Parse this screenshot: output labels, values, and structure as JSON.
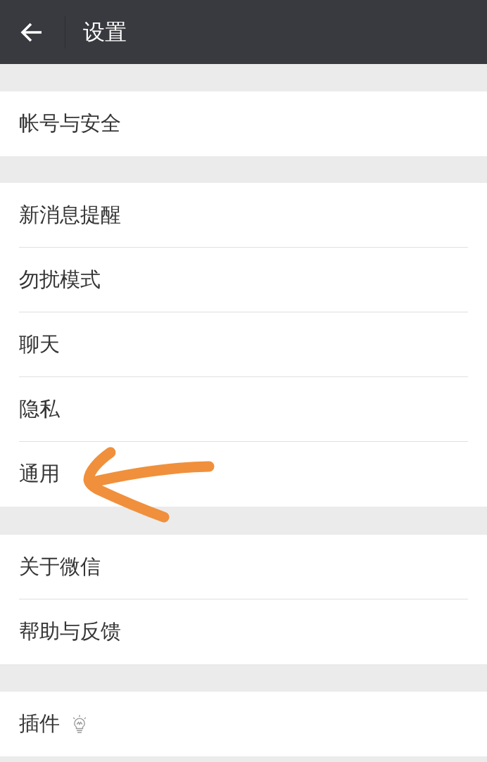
{
  "header": {
    "title": "设置"
  },
  "groups": [
    {
      "rows": [
        {
          "label": "帐号与安全",
          "kind": "text",
          "marked": false
        }
      ]
    },
    {
      "rows": [
        {
          "label": "新消息提醒",
          "kind": "text",
          "marked": false
        },
        {
          "label": "勿扰模式",
          "kind": "text",
          "marked": false
        },
        {
          "label": "聊天",
          "kind": "text",
          "marked": false
        },
        {
          "label": "隐私",
          "kind": "text",
          "marked": false
        },
        {
          "label": "通用",
          "kind": "text",
          "marked": true
        }
      ]
    },
    {
      "rows": [
        {
          "label": "关于微信",
          "kind": "text",
          "marked": false
        },
        {
          "label": "帮助与反馈",
          "kind": "text",
          "marked": false
        }
      ]
    },
    {
      "rows": [
        {
          "label": "插件",
          "kind": "text_icon",
          "marked": false
        }
      ]
    }
  ]
}
